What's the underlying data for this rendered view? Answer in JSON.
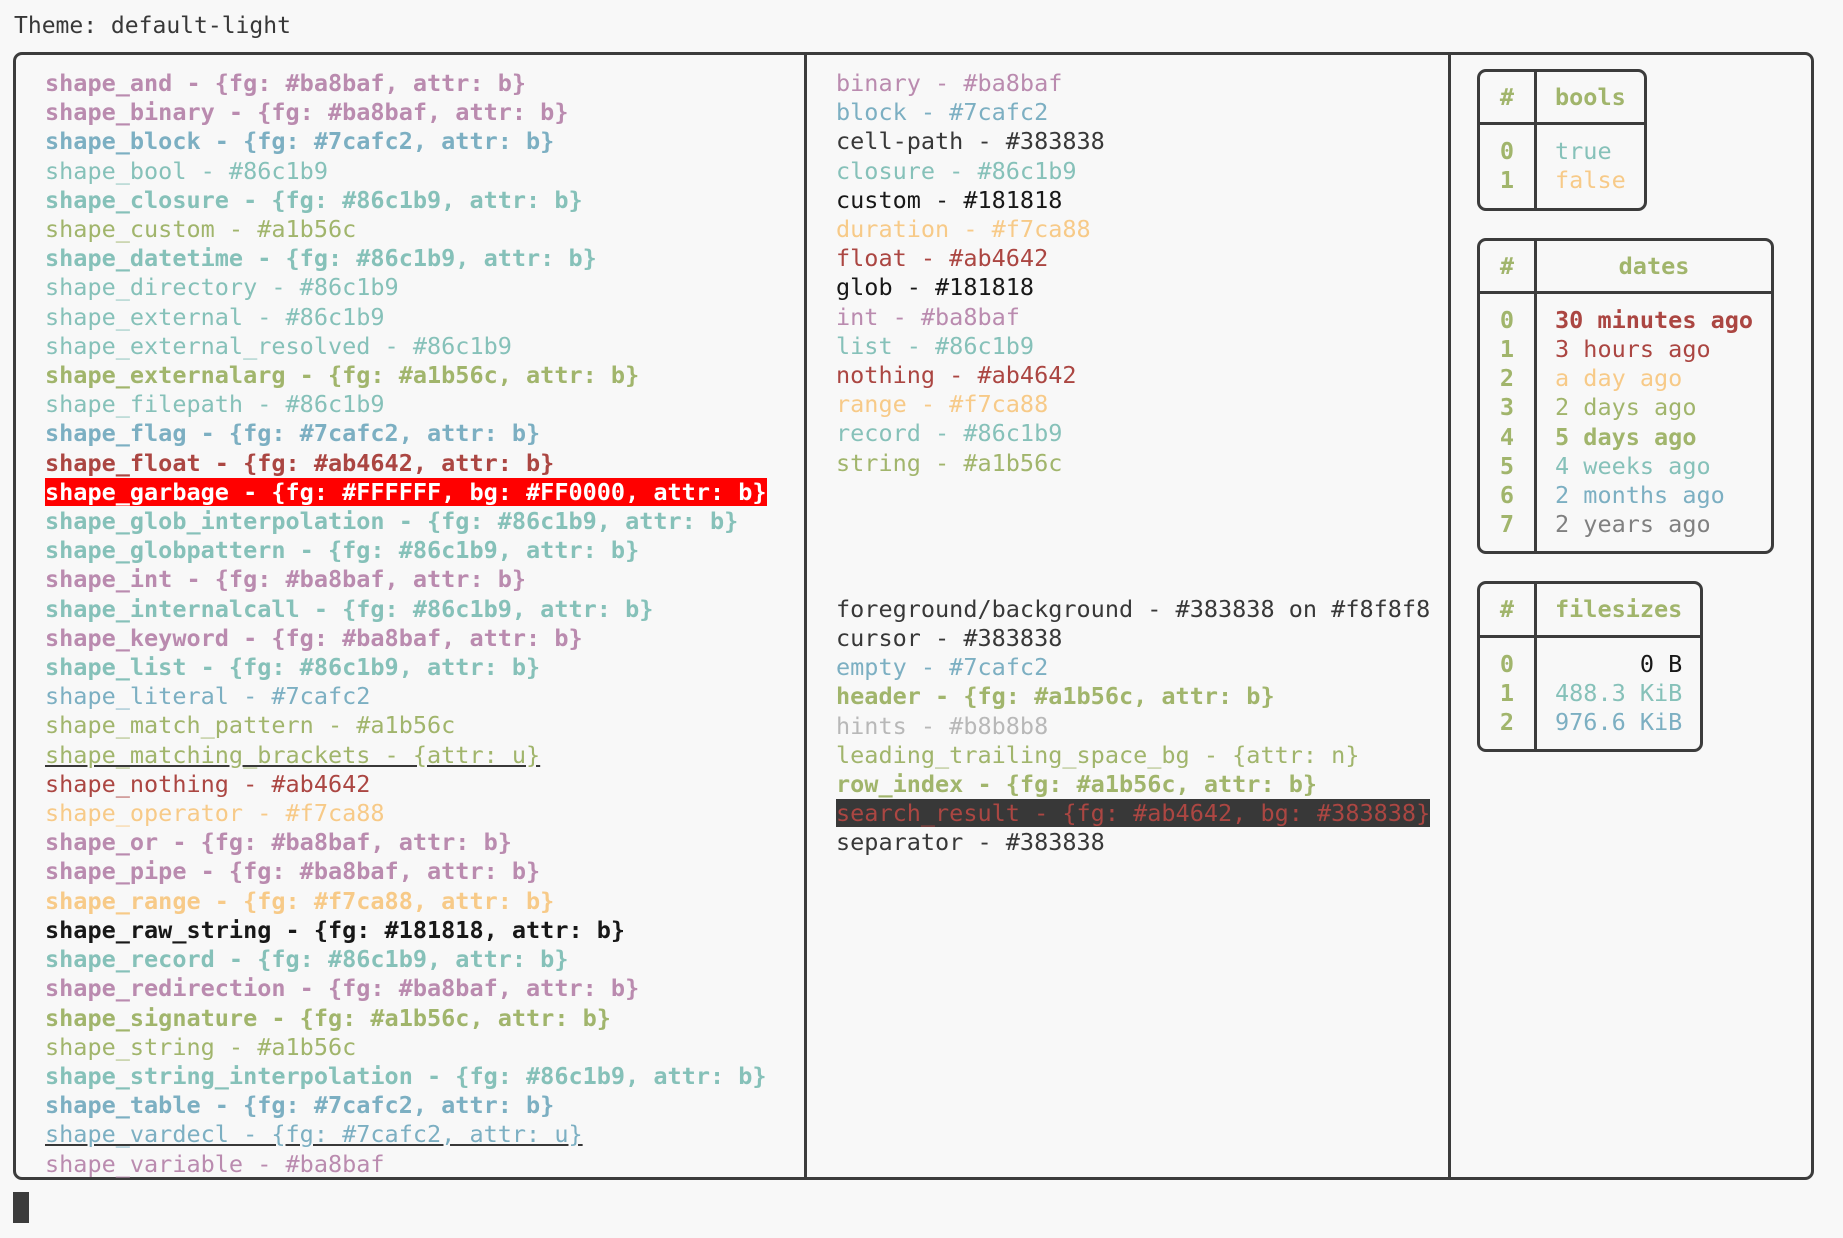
{
  "header": {
    "label": "Theme: default-light"
  },
  "palette": {
    "purple": "#ba8baf",
    "blue": "#7cafc2",
    "teal": "#86c1b9",
    "olive": "#a1b56c",
    "orange": "#f7ca88",
    "red": "#ab4642",
    "black": "#181818",
    "dark": "#383838",
    "gray": "#b8b8b8",
    "hl_red_bg": "#FF0000",
    "hl_red_fg": "#FFFFFF",
    "hl_dark_bg": "#383838",
    "background": "#f8f8f8",
    "border": "#3c3c3c"
  },
  "shapes_column": [
    {
      "text": "shape_and - {fg: #ba8baf, attr: b}",
      "fg": "#ba8baf",
      "bold": true
    },
    {
      "text": "shape_binary - {fg: #ba8baf, attr: b}",
      "fg": "#ba8baf",
      "bold": true
    },
    {
      "text": "shape_block - {fg: #7cafc2, attr: b}",
      "fg": "#7cafc2",
      "bold": true
    },
    {
      "text": "shape_bool - #86c1b9",
      "fg": "#86c1b9",
      "bold": false
    },
    {
      "text": "shape_closure - {fg: #86c1b9, attr: b}",
      "fg": "#86c1b9",
      "bold": true
    },
    {
      "text": "shape_custom - #a1b56c",
      "fg": "#a1b56c",
      "bold": false
    },
    {
      "text": "shape_datetime - {fg: #86c1b9, attr: b}",
      "fg": "#86c1b9",
      "bold": true
    },
    {
      "text": "shape_directory - #86c1b9",
      "fg": "#86c1b9",
      "bold": false
    },
    {
      "text": "shape_external - #86c1b9",
      "fg": "#86c1b9",
      "bold": false
    },
    {
      "text": "shape_external_resolved - #86c1b9",
      "fg": "#86c1b9",
      "bold": false
    },
    {
      "text": "shape_externalarg - {fg: #a1b56c, attr: b}",
      "fg": "#a1b56c",
      "bold": true
    },
    {
      "text": "shape_filepath - #86c1b9",
      "fg": "#86c1b9",
      "bold": false
    },
    {
      "text": "shape_flag - {fg: #7cafc2, attr: b}",
      "fg": "#7cafc2",
      "bold": true
    },
    {
      "text": "shape_float - {fg: #ab4642, attr: b}",
      "fg": "#ab4642",
      "bold": true
    },
    {
      "text": "shape_garbage - {fg: #FFFFFF, bg: #FF0000, attr: b}",
      "fg": "#FFFFFF",
      "bg": "#FF0000",
      "bold": true
    },
    {
      "text": "shape_glob_interpolation - {fg: #86c1b9, attr: b}",
      "fg": "#86c1b9",
      "bold": true
    },
    {
      "text": "shape_globpattern - {fg: #86c1b9, attr: b}",
      "fg": "#86c1b9",
      "bold": true
    },
    {
      "text": "shape_int - {fg: #ba8baf, attr: b}",
      "fg": "#ba8baf",
      "bold": true
    },
    {
      "text": "shape_internalcall - {fg: #86c1b9, attr: b}",
      "fg": "#86c1b9",
      "bold": true
    },
    {
      "text": "shape_keyword - {fg: #ba8baf, attr: b}",
      "fg": "#ba8baf",
      "bold": true
    },
    {
      "text": "shape_list - {fg: #86c1b9, attr: b}",
      "fg": "#86c1b9",
      "bold": true
    },
    {
      "text": "shape_literal - #7cafc2",
      "fg": "#7cafc2",
      "bold": false
    },
    {
      "text": "shape_match_pattern - #a1b56c",
      "fg": "#a1b56c",
      "bold": false
    },
    {
      "text": "shape_matching_brackets - {attr: u}",
      "fg": "#a1b56c",
      "bold": false,
      "underline": true
    },
    {
      "text": "shape_nothing - #ab4642",
      "fg": "#ab4642",
      "bold": false
    },
    {
      "text": "shape_operator - #f7ca88",
      "fg": "#f7ca88",
      "bold": false
    },
    {
      "text": "shape_or - {fg: #ba8baf, attr: b}",
      "fg": "#ba8baf",
      "bold": true
    },
    {
      "text": "shape_pipe - {fg: #ba8baf, attr: b}",
      "fg": "#ba8baf",
      "bold": true
    },
    {
      "text": "shape_range - {fg: #f7ca88, attr: b}",
      "fg": "#f7ca88",
      "bold": true
    },
    {
      "text": "shape_raw_string - {fg: #181818, attr: b}",
      "fg": "#181818",
      "bold": true
    },
    {
      "text": "shape_record - {fg: #86c1b9, attr: b}",
      "fg": "#86c1b9",
      "bold": true
    },
    {
      "text": "shape_redirection - {fg: #ba8baf, attr: b}",
      "fg": "#ba8baf",
      "bold": true
    },
    {
      "text": "shape_signature - {fg: #a1b56c, attr: b}",
      "fg": "#a1b56c",
      "bold": true
    },
    {
      "text": "shape_string - #a1b56c",
      "fg": "#a1b56c",
      "bold": false
    },
    {
      "text": "shape_string_interpolation - {fg: #86c1b9, attr: b}",
      "fg": "#86c1b9",
      "bold": true
    },
    {
      "text": "shape_table - {fg: #7cafc2, attr: b}",
      "fg": "#7cafc2",
      "bold": true
    },
    {
      "text": "shape_vardecl - {fg: #7cafc2, attr: u}",
      "fg": "#7cafc2",
      "bold": false,
      "underline": true
    },
    {
      "text": "shape_variable - #ba8baf",
      "fg": "#ba8baf",
      "bold": false
    }
  ],
  "types_column": [
    {
      "text": "binary - #ba8baf",
      "fg": "#ba8baf",
      "bold": false
    },
    {
      "text": "block - #7cafc2",
      "fg": "#7cafc2",
      "bold": false
    },
    {
      "text": "cell-path - #383838",
      "fg": "#383838",
      "bold": false
    },
    {
      "text": "closure - #86c1b9",
      "fg": "#86c1b9",
      "bold": false
    },
    {
      "text": "custom - #181818",
      "fg": "#181818",
      "bold": false
    },
    {
      "text": "duration - #f7ca88",
      "fg": "#f7ca88",
      "bold": false
    },
    {
      "text": "float - #ab4642",
      "fg": "#ab4642",
      "bold": false
    },
    {
      "text": "glob - #181818",
      "fg": "#181818",
      "bold": false
    },
    {
      "text": "int - #ba8baf",
      "fg": "#ba8baf",
      "bold": false
    },
    {
      "text": "list - #86c1b9",
      "fg": "#86c1b9",
      "bold": false
    },
    {
      "text": "nothing - #ab4642",
      "fg": "#ab4642",
      "bold": false
    },
    {
      "text": "range - #f7ca88",
      "fg": "#f7ca88",
      "bold": false
    },
    {
      "text": "record - #86c1b9",
      "fg": "#86c1b9",
      "bold": false
    },
    {
      "text": "string - #a1b56c",
      "fg": "#a1b56c",
      "bold": false
    }
  ],
  "ui_column": [
    {
      "text": "foreground/background - #383838 on #f8f8f8",
      "fg": "#383838",
      "bold": false
    },
    {
      "text": "cursor - #383838",
      "fg": "#383838",
      "bold": false
    },
    {
      "text": "empty - #7cafc2",
      "fg": "#7cafc2",
      "bold": false
    },
    {
      "text": "header - {fg: #a1b56c, attr: b}",
      "fg": "#a1b56c",
      "bold": true
    },
    {
      "text": "hints - #b8b8b8",
      "fg": "#b8b8b8",
      "bold": false
    },
    {
      "text": "leading_trailing_space_bg - {attr: n}",
      "fg": "#a1b56c",
      "bold": false
    },
    {
      "text": "row_index - {fg: #a1b56c, attr: b}",
      "fg": "#a1b56c",
      "bold": true
    },
    {
      "text": "search_result - {fg: #ab4642, bg: #383838}",
      "fg": "#ab4642",
      "bg": "#383838",
      "bold": false
    },
    {
      "text": "separator - #383838",
      "fg": "#383838",
      "bold": false
    }
  ],
  "tables": [
    {
      "name": "bools-table",
      "index_header": "#",
      "value_header": "bools",
      "align": "left",
      "rows": [
        {
          "index": "0",
          "value": "true",
          "fg": "#86c1b9",
          "bold": false
        },
        {
          "index": "1",
          "value": "false",
          "fg": "#f7ca88",
          "bold": false
        }
      ]
    },
    {
      "name": "dates-table",
      "index_header": "#",
      "value_header": "dates",
      "align": "left",
      "rows": [
        {
          "index": "0",
          "value": "30 minutes ago",
          "fg": "#ab4642",
          "bold": true
        },
        {
          "index": "1",
          "value": "3 hours ago",
          "fg": "#ab4642",
          "bold": false
        },
        {
          "index": "2",
          "value": "a day ago",
          "fg": "#f7ca88",
          "bold": false
        },
        {
          "index": "3",
          "value": "2 days ago",
          "fg": "#a1b56c",
          "bold": false
        },
        {
          "index": "4",
          "value": "5 days ago",
          "fg": "#a1b56c",
          "bold": true
        },
        {
          "index": "5",
          "value": "4 weeks ago",
          "fg": "#86c1b9",
          "bold": false
        },
        {
          "index": "6",
          "value": "2 months ago",
          "fg": "#7cafc2",
          "bold": false
        },
        {
          "index": "7",
          "value": "2 years ago",
          "fg": "#808080",
          "bold": false
        }
      ]
    },
    {
      "name": "filesizes-table",
      "index_header": "#",
      "value_header": "filesizes",
      "align": "right",
      "rows": [
        {
          "index": "0",
          "value": "0 B",
          "fg": "#181818",
          "bold": false
        },
        {
          "index": "1",
          "value": "488.3 KiB",
          "fg": "#86c1b9",
          "bold": false
        },
        {
          "index": "2",
          "value": "976.6 KiB",
          "fg": "#7cafc2",
          "bold": false
        }
      ]
    }
  ]
}
